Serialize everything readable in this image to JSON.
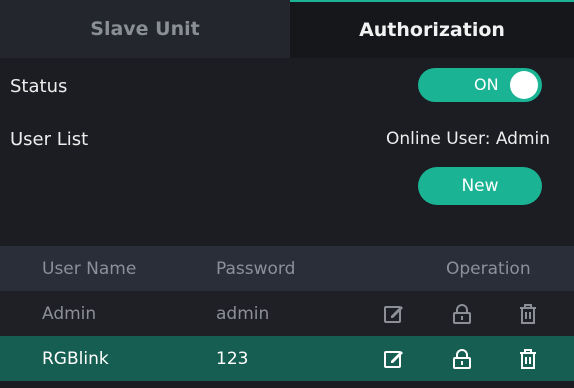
{
  "tabs": [
    {
      "label": "Slave Unit",
      "active": false
    },
    {
      "label": "Authorization",
      "active": true
    }
  ],
  "status": {
    "label": "Status",
    "toggle_text": "ON",
    "state": "on"
  },
  "user_list": {
    "label": "User List",
    "online_user": "Online User: Admin",
    "new_button": "New"
  },
  "table": {
    "headers": {
      "user_name": "User Name",
      "password": "Password",
      "operation": "Operation"
    },
    "rows": [
      {
        "user_name": "Admin",
        "password": "admin"
      },
      {
        "user_name": "RGBlink",
        "password": "123"
      }
    ]
  },
  "icons": {
    "edit": "edit-icon",
    "lock": "lock-icon",
    "delete": "trash-icon"
  },
  "colors": {
    "accent": "#1ab394",
    "selected_row": "#175e52",
    "header_row": "#2a2e38"
  }
}
